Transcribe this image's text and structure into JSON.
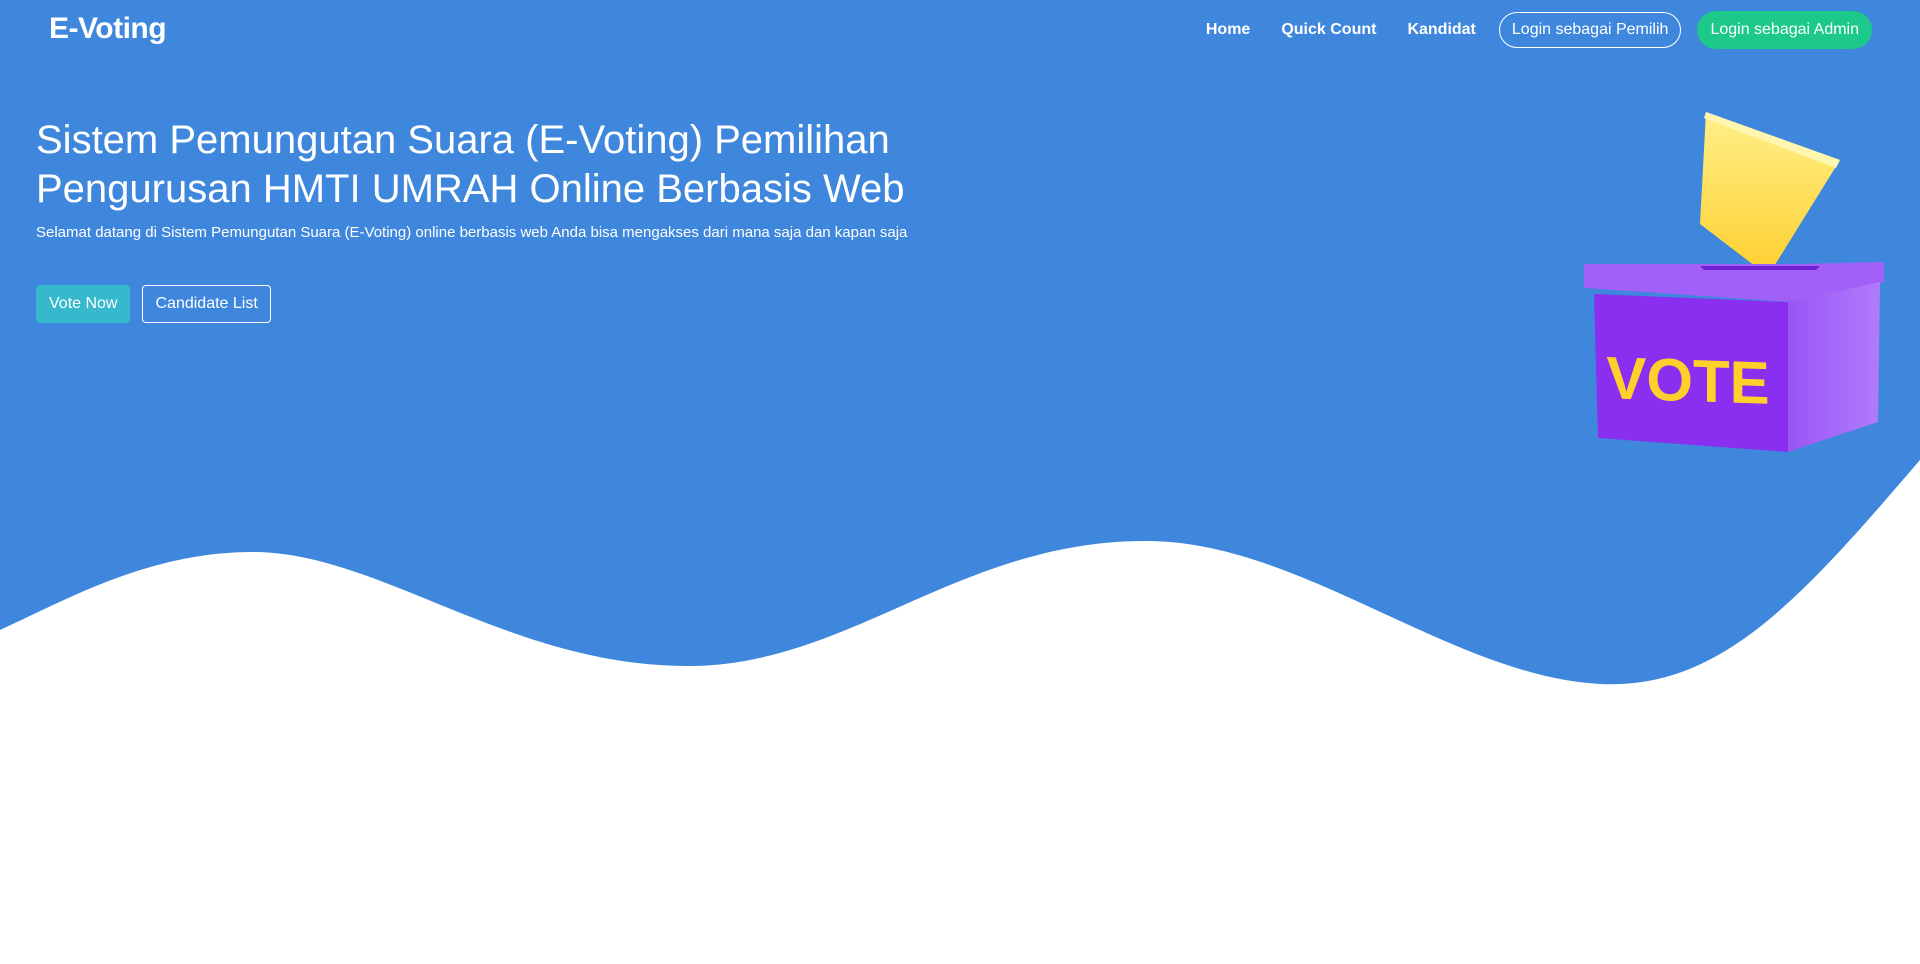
{
  "colors": {
    "hero_background": "#3e87dc",
    "admin_button": "#1cc88a",
    "vote_button": "#36b9cc",
    "ballot_box": "#8a2ff0",
    "ballot_box_text": "#ffd02a",
    "ballot_paper": "#ffe066"
  },
  "navbar": {
    "brand": "E-Voting",
    "links": [
      "Home",
      "Quick Count",
      "Kandidat"
    ],
    "login_voter": "Login sebagai Pemilih",
    "login_admin": "Login sebagai Admin"
  },
  "hero": {
    "title": "Sistem Pemungutan Suara (E-Voting) Pemilihan Pengurusan HMTI UMRAH Online Berbasis Web",
    "subtitle": "Selamat datang di Sistem Pemungutan Suara (E-Voting) online berbasis web Anda bisa mengakses dari mana saja dan kapan saja",
    "vote_button": "Vote Now",
    "candidate_button": "Candidate List",
    "illustration": {
      "icon": "ballot-box-icon",
      "box_label": "VOTE"
    }
  }
}
